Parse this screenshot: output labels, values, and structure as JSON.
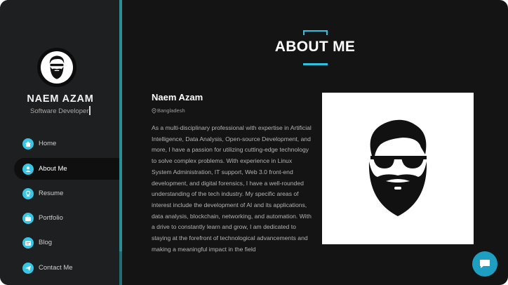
{
  "profile": {
    "name": "NAEM AZAM",
    "role": "Software Developer"
  },
  "nav": {
    "items": [
      {
        "label": "Home",
        "icon": "home-icon",
        "active": false
      },
      {
        "label": "About Me",
        "icon": "user-icon",
        "active": true
      },
      {
        "label": "Resume",
        "icon": "resume-icon",
        "active": false
      },
      {
        "label": "Portfolio",
        "icon": "portfolio-icon",
        "active": false
      },
      {
        "label": "Blog",
        "icon": "blog-icon",
        "active": false
      },
      {
        "label": "Contact Me",
        "icon": "send-icon",
        "active": false
      }
    ]
  },
  "main": {
    "title": "ABOUT ME",
    "name": "Naem Azam",
    "location": "Bangladesh",
    "bio": "As a multi-disciplinary professional with expertise in Artificial Intelligence, Data Analysis, Open-source Development, and more, I have a passion for utilizing cutting-edge technology to solve complex problems. With experience in Linux System Administration, IT support, Web 3.0 front-end development, and digital forensics, I have a well-rounded understanding of the tech industry. My specific areas of interest include the development of AI and its applications, data analysis, blockchain, networking, and automation. With a drive to constantly learn and grow, I am dedicated to staying at the forefront of technological advancements and making a meaningful impact in the field"
  },
  "colors": {
    "accent": "#38c6e4",
    "sidebar": "#1e1f20",
    "background": "#141414"
  }
}
